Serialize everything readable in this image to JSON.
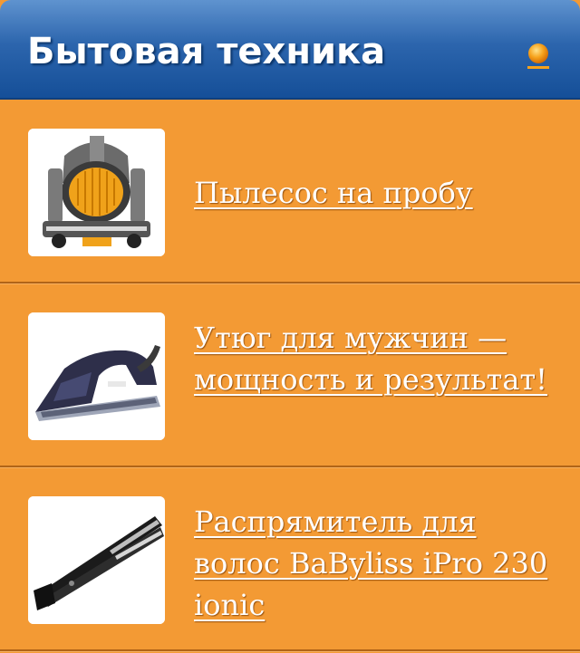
{
  "widget": {
    "title": "Бытовая техника",
    "icons": {
      "header": "rss-feed-icon"
    },
    "colors": {
      "header": "#2c65ad",
      "body": "#f39a34",
      "separator": "#b06418"
    },
    "items": [
      {
        "label": "Пылесос на пробу",
        "thumbnail": "vacuum-cleaner-thumbnail"
      },
      {
        "label": "Утюг для мужчин — мощность и результат!",
        "thumbnail": "iron-thumbnail"
      },
      {
        "label": "Распрямитель для волос BaByliss iPro 230 ionic",
        "thumbnail": "hair-straightener-thumbnail"
      }
    ]
  }
}
